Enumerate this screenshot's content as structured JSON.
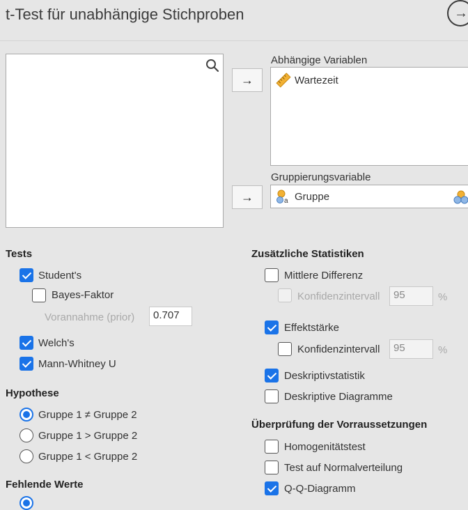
{
  "header": {
    "title": "t-Test für unabhängige Stichproben"
  },
  "variables": {
    "dependent_label": "Abhängige Variablen",
    "dependent_items": [
      "Wartezeit"
    ],
    "grouping_label": "Gruppierungsvariable",
    "grouping_item": "Gruppe"
  },
  "tests": {
    "heading": "Tests",
    "students": "Student's",
    "bayes": "Bayes-Faktor",
    "prior_label": "Vorannahme (prior)",
    "prior_value": "0.707",
    "welch": "Welch's",
    "mann_whitney": "Mann-Whitney U"
  },
  "hypothesis": {
    "heading": "Hypothese",
    "options": [
      "Gruppe 1 ≠ Gruppe 2",
      "Gruppe 1 > Gruppe 2",
      "Gruppe 1 < Gruppe 2"
    ],
    "selected": 0
  },
  "missing": {
    "heading": "Fehlende Werte"
  },
  "additional": {
    "heading": "Zusätzliche Statistiken",
    "mean_diff": "Mittlere Differenz",
    "ci_label": "Konfidenzintervall",
    "ci_value": "95",
    "ci_unit": "%",
    "effect_size": "Effektstärke",
    "ci2_label": "Konfidenzintervall",
    "ci2_value": "95",
    "ci2_unit": "%",
    "descriptives": "Deskriptivstatistik",
    "desc_plots": "Deskriptive Diagramme"
  },
  "assumptions": {
    "heading": "Überprüfung der Vorraussetzungen",
    "homogeneity": "Homogenitätstest",
    "normality": "Test auf Normalverteilung",
    "qq": "Q-Q-Diagramm"
  },
  "colors": {
    "accent": "#1a73e8",
    "background": "#e6e6e6"
  }
}
